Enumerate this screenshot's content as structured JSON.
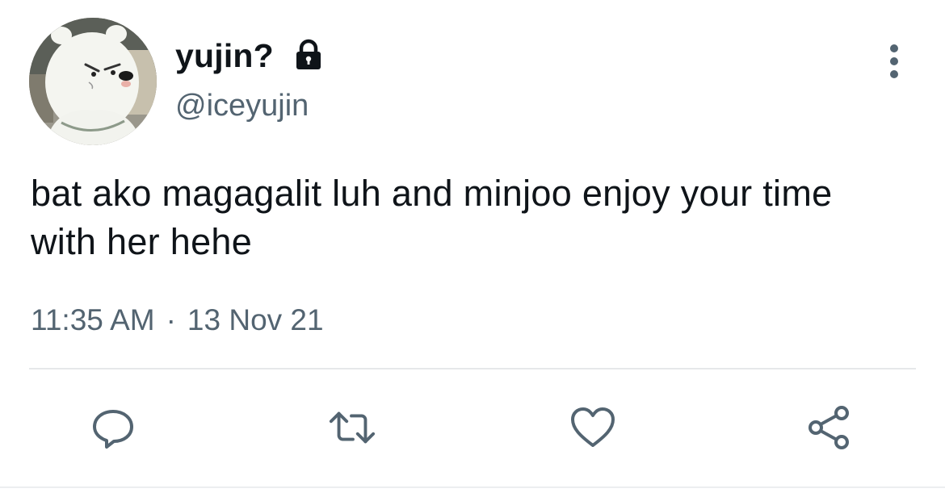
{
  "user": {
    "display_name": "yujin?",
    "handle": "@iceyujin",
    "avatar_icon": "polar-bear-avatar",
    "locked_icon": "lock-icon"
  },
  "tweet": {
    "text": "bat ako magagalit luh and minjoo enjoy your time with her hehe",
    "time": "11:35 AM",
    "separator": "·",
    "date": "13 Nov 21"
  },
  "actions": {
    "reply_icon": "reply-icon",
    "retweet_icon": "retweet-icon",
    "like_icon": "heart-icon",
    "share_icon": "share-icon",
    "more_icon": "more-vertical-icon"
  },
  "colors": {
    "text": "#0f1419",
    "secondary": "#536471",
    "divider": "#e6e8ea"
  }
}
